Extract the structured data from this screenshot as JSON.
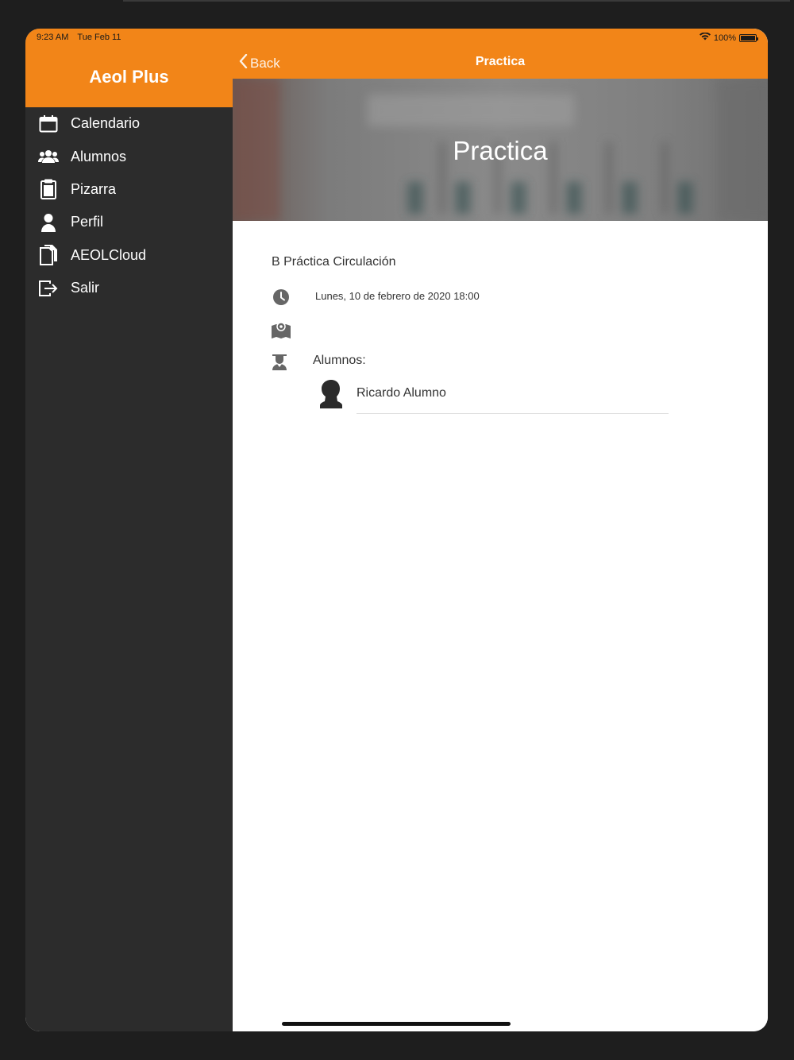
{
  "status_bar": {
    "time": "9:23 AM",
    "date": "Tue Feb 11",
    "battery": "100%",
    "wifi_icon": "wifi-icon",
    "battery_level": 1.0
  },
  "sidebar": {
    "title": "Aeol Plus",
    "items": [
      {
        "label": "Calendario",
        "icon": "calendar-icon"
      },
      {
        "label": "Alumnos",
        "icon": "users-icon"
      },
      {
        "label": "Pizarra",
        "icon": "clipboard-icon"
      },
      {
        "label": "Perfil",
        "icon": "user-icon"
      },
      {
        "label": "AEOLCloud",
        "icon": "files-icon"
      },
      {
        "label": "Salir",
        "icon": "logout-icon"
      }
    ]
  },
  "navbar": {
    "back_label": "Back",
    "title": "Practica"
  },
  "hero": {
    "title": "Practica"
  },
  "detail": {
    "practice_name": "B Práctica Circulación",
    "date": "Lunes, 10 de febrero de 2020 18:00",
    "location": "",
    "students_label": "Alumnos:",
    "students": [
      {
        "name": "Ricardo Alumno"
      }
    ]
  },
  "colors": {
    "accent": "#f28518",
    "sidebar_bg": "#2c2c2c",
    "frame_bg": "#1e1e1e"
  }
}
